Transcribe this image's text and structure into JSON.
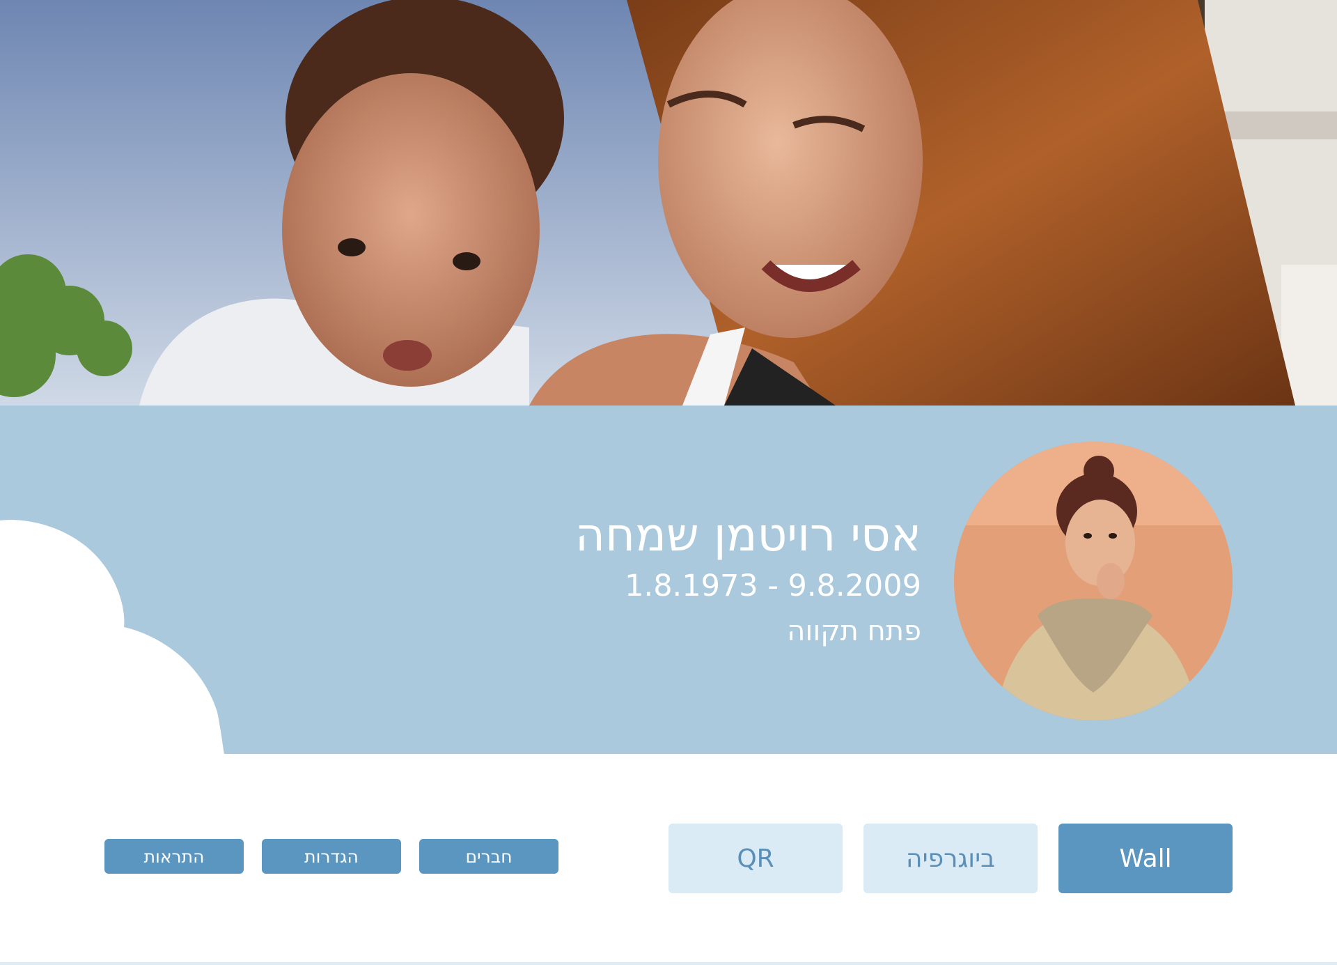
{
  "profile": {
    "name": "אסי רויטמן שמחה",
    "dates": "1.8.1973 - 9.8.2009",
    "location": "פתח תקווה"
  },
  "tabs": [
    {
      "label": "Wall",
      "active": true
    },
    {
      "label": "ביוגרפיה",
      "active": false
    },
    {
      "label": "QR",
      "active": false
    }
  ],
  "actions": {
    "friends": "חברים",
    "settings": "הגדרות",
    "alerts": "התראות"
  },
  "colors": {
    "band": "#abc9dd",
    "accent": "#5b96c1",
    "tab_inactive": "#daebf6",
    "text_on_band": "#ffffff"
  }
}
